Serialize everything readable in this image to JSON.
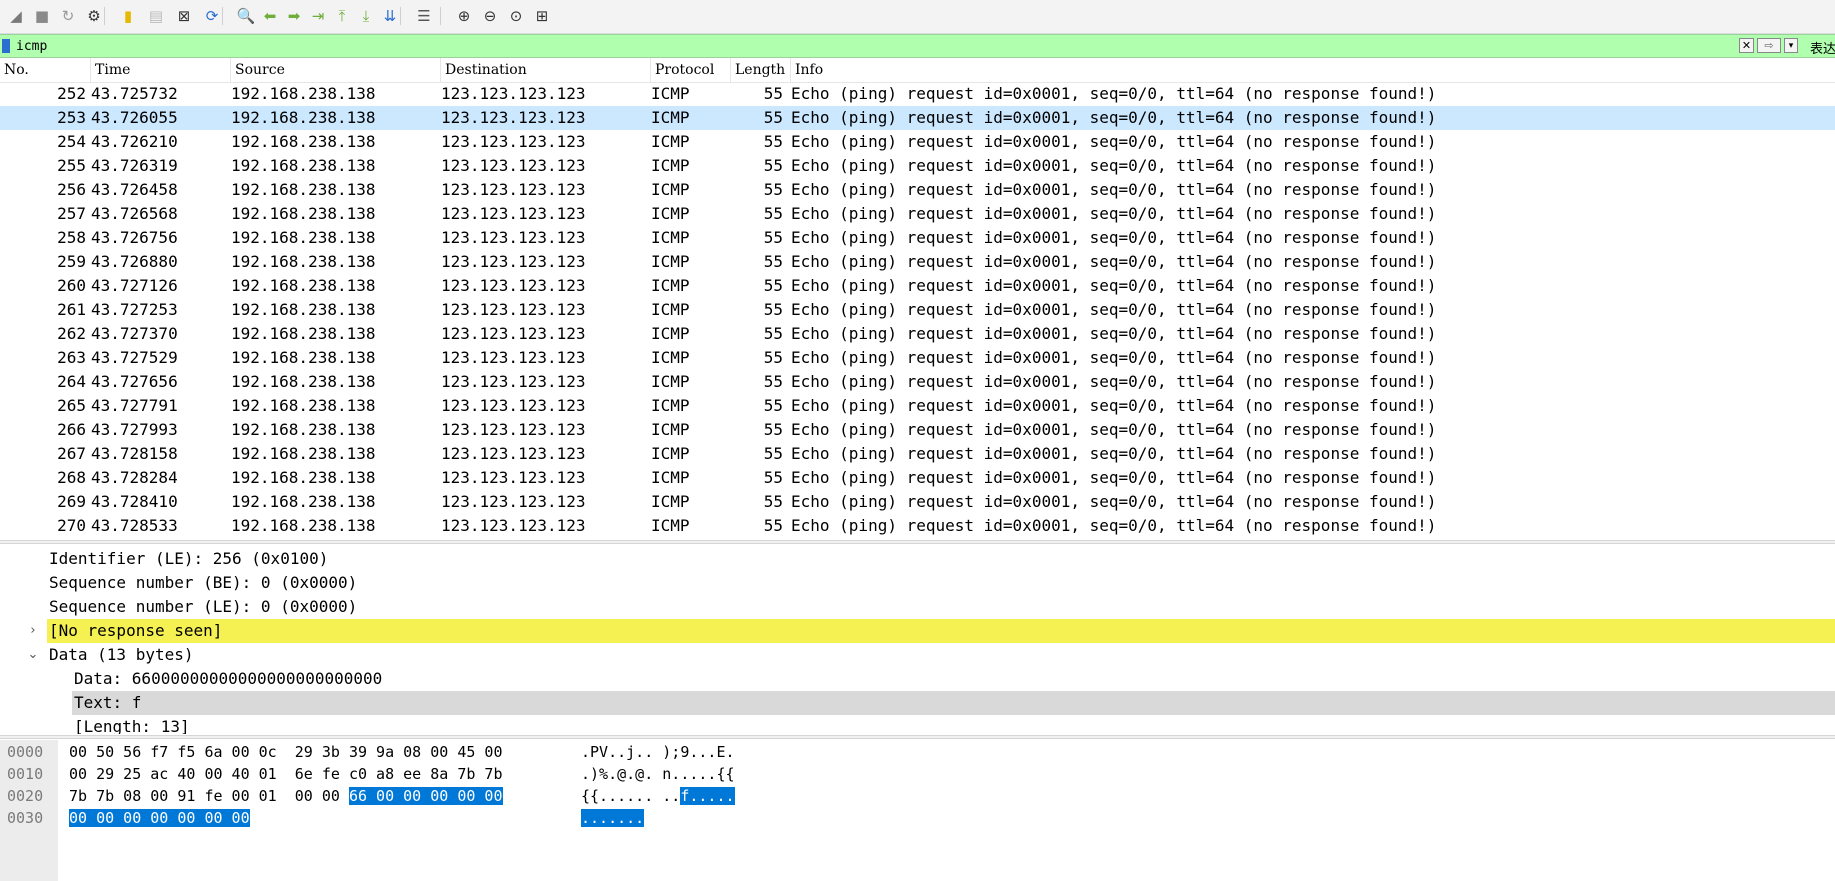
{
  "toolbar": {
    "buttons": [
      {
        "name": "start-capture-icon",
        "glyph": "◢",
        "color": "#7a7a7a"
      },
      {
        "name": "stop-capture-icon",
        "glyph": "■",
        "color": "#8a8a8a"
      },
      {
        "name": "restart-capture-icon",
        "glyph": "↻",
        "color": "#9a9a9a"
      },
      {
        "name": "capture-options-icon",
        "glyph": "⚙",
        "color": "#333333"
      },
      {
        "name": "open-file-icon",
        "glyph": "▮",
        "color": "#e6b800"
      },
      {
        "name": "save-file-icon",
        "glyph": "▤",
        "color": "#bbbbbb"
      },
      {
        "name": "close-file-icon",
        "glyph": "⊠",
        "color": "#333333"
      },
      {
        "name": "reload-file-icon",
        "glyph": "⟳",
        "color": "#2b6fd1"
      },
      {
        "name": "find-packet-icon",
        "glyph": "🔍",
        "color": "#333333"
      },
      {
        "name": "go-back-icon",
        "glyph": "⬅",
        "color": "#6fae3a"
      },
      {
        "name": "go-forward-icon",
        "glyph": "➡",
        "color": "#6fae3a"
      },
      {
        "name": "go-to-packet-icon",
        "glyph": "⇥",
        "color": "#6fae3a"
      },
      {
        "name": "first-packet-icon",
        "glyph": "⤒",
        "color": "#6fae3a"
      },
      {
        "name": "last-packet-icon",
        "glyph": "⤓",
        "color": "#6fae3a"
      },
      {
        "name": "auto-scroll-icon",
        "glyph": "⇊",
        "color": "#2b6fd1"
      },
      {
        "name": "colorize-icon",
        "glyph": "☰",
        "color": "#555555"
      },
      {
        "name": "zoom-in-icon",
        "glyph": "⊕",
        "color": "#333333"
      },
      {
        "name": "zoom-out-icon",
        "glyph": "⊖",
        "color": "#333333"
      },
      {
        "name": "normal-size-icon",
        "glyph": "⊙",
        "color": "#333333"
      },
      {
        "name": "resize-columns-icon",
        "glyph": "⊞",
        "color": "#333333"
      }
    ]
  },
  "filter": {
    "value": "icmp",
    "clear_glyph": "✕",
    "apply_glyph": "⇨",
    "dropdown_glyph": "▾",
    "expression_label": "表达",
    "background": "#afffaf"
  },
  "packet_list": {
    "columns": [
      "No.",
      "Time",
      "Source",
      "Destination",
      "Protocol",
      "Length",
      "Info"
    ],
    "selected_index": 1,
    "selected_color": "#cce8ff",
    "rows": [
      {
        "no": "252",
        "time": "43.725732",
        "src": "192.168.238.138",
        "dst": "123.123.123.123",
        "proto": "ICMP",
        "len": "55",
        "info": "Echo (ping) request  id=0x0001, seq=0/0, ttl=64 (no response found!)"
      },
      {
        "no": "253",
        "time": "43.726055",
        "src": "192.168.238.138",
        "dst": "123.123.123.123",
        "proto": "ICMP",
        "len": "55",
        "info": "Echo (ping) request  id=0x0001, seq=0/0, ttl=64 (no response found!)"
      },
      {
        "no": "254",
        "time": "43.726210",
        "src": "192.168.238.138",
        "dst": "123.123.123.123",
        "proto": "ICMP",
        "len": "55",
        "info": "Echo (ping) request  id=0x0001, seq=0/0, ttl=64 (no response found!)"
      },
      {
        "no": "255",
        "time": "43.726319",
        "src": "192.168.238.138",
        "dst": "123.123.123.123",
        "proto": "ICMP",
        "len": "55",
        "info": "Echo (ping) request  id=0x0001, seq=0/0, ttl=64 (no response found!)"
      },
      {
        "no": "256",
        "time": "43.726458",
        "src": "192.168.238.138",
        "dst": "123.123.123.123",
        "proto": "ICMP",
        "len": "55",
        "info": "Echo (ping) request  id=0x0001, seq=0/0, ttl=64 (no response found!)"
      },
      {
        "no": "257",
        "time": "43.726568",
        "src": "192.168.238.138",
        "dst": "123.123.123.123",
        "proto": "ICMP",
        "len": "55",
        "info": "Echo (ping) request  id=0x0001, seq=0/0, ttl=64 (no response found!)"
      },
      {
        "no": "258",
        "time": "43.726756",
        "src": "192.168.238.138",
        "dst": "123.123.123.123",
        "proto": "ICMP",
        "len": "55",
        "info": "Echo (ping) request  id=0x0001, seq=0/0, ttl=64 (no response found!)"
      },
      {
        "no": "259",
        "time": "43.726880",
        "src": "192.168.238.138",
        "dst": "123.123.123.123",
        "proto": "ICMP",
        "len": "55",
        "info": "Echo (ping) request  id=0x0001, seq=0/0, ttl=64 (no response found!)"
      },
      {
        "no": "260",
        "time": "43.727126",
        "src": "192.168.238.138",
        "dst": "123.123.123.123",
        "proto": "ICMP",
        "len": "55",
        "info": "Echo (ping) request  id=0x0001, seq=0/0, ttl=64 (no response found!)"
      },
      {
        "no": "261",
        "time": "43.727253",
        "src": "192.168.238.138",
        "dst": "123.123.123.123",
        "proto": "ICMP",
        "len": "55",
        "info": "Echo (ping) request  id=0x0001, seq=0/0, ttl=64 (no response found!)"
      },
      {
        "no": "262",
        "time": "43.727370",
        "src": "192.168.238.138",
        "dst": "123.123.123.123",
        "proto": "ICMP",
        "len": "55",
        "info": "Echo (ping) request  id=0x0001, seq=0/0, ttl=64 (no response found!)"
      },
      {
        "no": "263",
        "time": "43.727529",
        "src": "192.168.238.138",
        "dst": "123.123.123.123",
        "proto": "ICMP",
        "len": "55",
        "info": "Echo (ping) request  id=0x0001, seq=0/0, ttl=64 (no response found!)"
      },
      {
        "no": "264",
        "time": "43.727656",
        "src": "192.168.238.138",
        "dst": "123.123.123.123",
        "proto": "ICMP",
        "len": "55",
        "info": "Echo (ping) request  id=0x0001, seq=0/0, ttl=64 (no response found!)"
      },
      {
        "no": "265",
        "time": "43.727791",
        "src": "192.168.238.138",
        "dst": "123.123.123.123",
        "proto": "ICMP",
        "len": "55",
        "info": "Echo (ping) request  id=0x0001, seq=0/0, ttl=64 (no response found!)"
      },
      {
        "no": "266",
        "time": "43.727993",
        "src": "192.168.238.138",
        "dst": "123.123.123.123",
        "proto": "ICMP",
        "len": "55",
        "info": "Echo (ping) request  id=0x0001, seq=0/0, ttl=64 (no response found!)"
      },
      {
        "no": "267",
        "time": "43.728158",
        "src": "192.168.238.138",
        "dst": "123.123.123.123",
        "proto": "ICMP",
        "len": "55",
        "info": "Echo (ping) request  id=0x0001, seq=0/0, ttl=64 (no response found!)"
      },
      {
        "no": "268",
        "time": "43.728284",
        "src": "192.168.238.138",
        "dst": "123.123.123.123",
        "proto": "ICMP",
        "len": "55",
        "info": "Echo (ping) request  id=0x0001, seq=0/0, ttl=64 (no response found!)"
      },
      {
        "no": "269",
        "time": "43.728410",
        "src": "192.168.238.138",
        "dst": "123.123.123.123",
        "proto": "ICMP",
        "len": "55",
        "info": "Echo (ping) request  id=0x0001, seq=0/0, ttl=64 (no response found!)"
      },
      {
        "no": "270",
        "time": "43.728533",
        "src": "192.168.238.138",
        "dst": "123.123.123.123",
        "proto": "ICMP",
        "len": "55",
        "info": "Echo (ping) request  id=0x0001, seq=0/0, ttl=64 (no response found!)"
      }
    ]
  },
  "details": {
    "highlight_yellow": "#f6f152",
    "highlight_gray": "#d9d9d9",
    "rows": [
      {
        "text": "Identifier (LE): 256 (0x0100)",
        "level": 1,
        "arrow": "",
        "hl": ""
      },
      {
        "text": "Sequence number (BE): 0 (0x0000)",
        "level": 1,
        "arrow": "",
        "hl": ""
      },
      {
        "text": "Sequence number (LE): 0 (0x0000)",
        "level": 1,
        "arrow": "",
        "hl": ""
      },
      {
        "text": "[No response seen]",
        "level": 1,
        "arrow": "›",
        "hl": "yellow"
      },
      {
        "text": "Data (13 bytes)",
        "level": 1,
        "arrow": "⌄",
        "hl": ""
      },
      {
        "text": "Data: 66000000000000000000000000",
        "level": 2,
        "arrow": "",
        "hl": ""
      },
      {
        "text": "Text: f",
        "level": 2,
        "arrow": "",
        "hl": "gray"
      },
      {
        "text": "[Length: 13]",
        "level": 2,
        "arrow": "",
        "hl": ""
      }
    ]
  },
  "hex": {
    "selection_color": "#0078d7",
    "lines": [
      {
        "offset": "0000",
        "bytes_plain": "00 50 56 f7 f5 6a 00 0c  29 3b 39 9a 08 00 45 00",
        "bytes_sel": "",
        "bytes_after": "",
        "ascii_plain": ".PV..j.. );9...E.",
        "ascii_sel": ""
      },
      {
        "offset": "0010",
        "bytes_plain": "00 29 25 ac 40 00 40 01  6e fe c0 a8 ee 8a 7b 7b",
        "bytes_sel": "",
        "bytes_after": "",
        "ascii_plain": ".)%.@.@. n.....{{",
        "ascii_sel": ""
      },
      {
        "offset": "0020",
        "bytes_plain": "7b 7b 08 00 91 fe 00 01  00 00 ",
        "bytes_sel": "66 00 00 00 00 00",
        "bytes_after": "",
        "ascii_plain": "{{...... ..",
        "ascii_sel": "f....."
      },
      {
        "offset": "0030",
        "bytes_plain": "",
        "bytes_sel": "00 00 00 00 00 00 00",
        "bytes_after": "",
        "ascii_plain": "",
        "ascii_sel": "......."
      }
    ]
  }
}
